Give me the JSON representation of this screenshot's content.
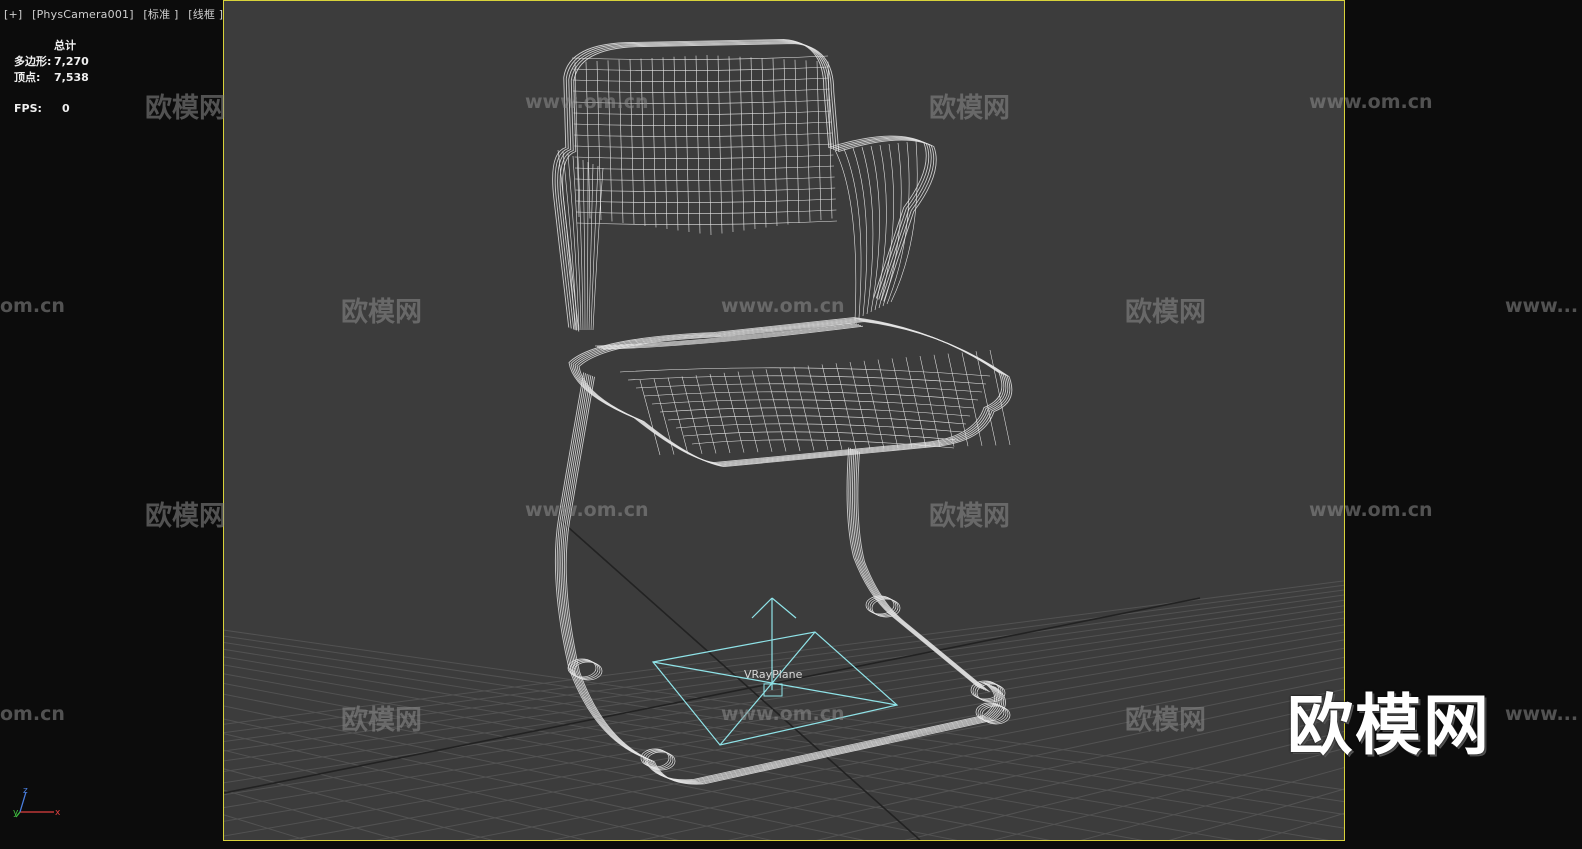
{
  "viewport": {
    "labels": [
      "[+]",
      "[PhysCamera001]",
      "[标准 ]",
      "[线框 ]"
    ]
  },
  "stats": {
    "title": "总计",
    "polygons_label": "多边形:",
    "polygons_value": "7,270",
    "vertices_label": "顶点:",
    "vertices_value": "7,538",
    "fps_label": "FPS:",
    "fps_value": "0"
  },
  "scene": {
    "object_label": "VRayPlane"
  },
  "watermark": {
    "brand": "欧模网",
    "url": "www.om.cn",
    "url_cut": "www...",
    "url_tail": "om.cn"
  },
  "logo": {
    "text": "欧模网"
  },
  "axis": {
    "x": "x",
    "y": "y",
    "z": "z"
  },
  "colors": {
    "viewport_bg": "#3c3c3c",
    "border_active": "#d8d23a",
    "wireframe": "#e8e8e8",
    "gizmo": "#8fe3e8",
    "grid": "#555555"
  }
}
